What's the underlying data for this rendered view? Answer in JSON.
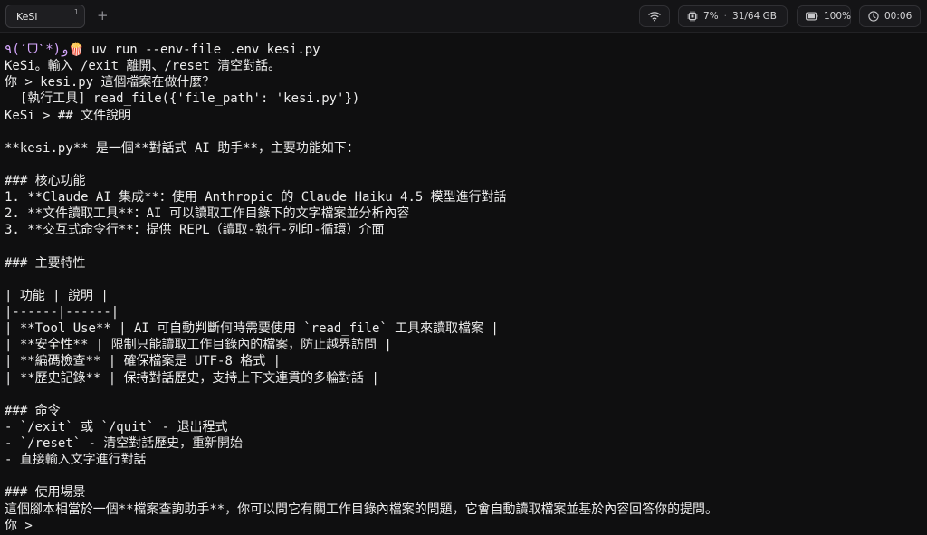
{
  "tabbar": {
    "tab_title": "KeSi",
    "tab_index": "1",
    "new_tab_label": "+"
  },
  "status": {
    "wifi_icon": "wifi-icon",
    "memory": {
      "icon": "memory-chip-icon",
      "cpu": "7%",
      "separator": "·",
      "mem": "31/64 GB"
    },
    "battery": {
      "icon": "battery-icon",
      "level": "100%"
    },
    "clock": {
      "icon": "clock-icon",
      "time": "00:06"
    }
  },
  "terminal": {
    "prompt_face": "٩(ˊᗜˋ*)و🍿",
    "command": " uv run --env-file .env kesi.py",
    "lines": [
      "KeSi。輸入 /exit 離開、/reset 清空對話。",
      "你 > kesi.py 這個檔案在做什麼？",
      "  [執行工具] read_file({'file_path': 'kesi.py'})",
      "KeSi > ## 文件說明",
      "",
      "**kesi.py** 是一個**對話式 AI 助手**，主要功能如下：",
      "",
      "### 核心功能",
      "1. **Claude AI 集成**：使用 Anthropic 的 Claude Haiku 4.5 模型進行對話",
      "2. **文件讀取工具**：AI 可以讀取工作目錄下的文字檔案並分析內容",
      "3. **交互式命令行**：提供 REPL（讀取-執行-列印-循環）介面",
      "",
      "### 主要特性",
      "",
      "| 功能 | 說明 |",
      "|------|------|",
      "| **Tool Use** | AI 可自動判斷何時需要使用 `read_file` 工具來讀取檔案 |",
      "| **安全性** | 限制只能讀取工作目錄內的檔案，防止越界訪問 |",
      "| **編碼檢查** | 確保檔案是 UTF-8 格式 |",
      "| **歷史記錄** | 保持對話歷史，支持上下文連貫的多輪對話 |",
      "",
      "### 命令",
      "- `/exit` 或 `/quit` - 退出程式",
      "- `/reset` - 清空對話歷史，重新開始",
      "- 直接輸入文字進行對話",
      "",
      "### 使用場景",
      "這個腳本相當於一個**檔案查詢助手**，你可以問它有關工作目錄內檔案的問題，它會自動讀取檔案並基於內容回答你的提問。",
      "你 > "
    ]
  },
  "colors": {
    "background": "#0f0f10",
    "titlebar": "#141416",
    "text": "#ececec",
    "prompt_accent": "#d7a8ff"
  }
}
